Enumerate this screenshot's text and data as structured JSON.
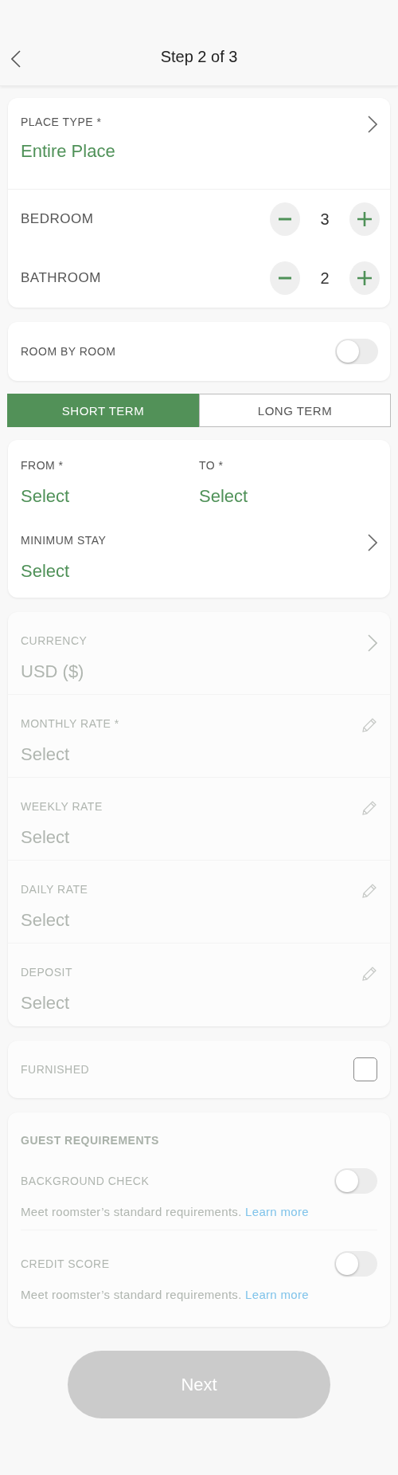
{
  "header": {
    "title": "Step 2 of 3"
  },
  "property": {
    "place_type": {
      "label": "PLACE TYPE *",
      "value": "Entire Place"
    },
    "counters": [
      {
        "label": "BEDROOM",
        "value": "3"
      },
      {
        "label": "BATHROOM",
        "value": "2"
      }
    ]
  },
  "room_by_room": {
    "label": "ROOM BY ROOM",
    "on": false
  },
  "term_tabs": [
    {
      "label": "SHORT TERM",
      "selected": true
    },
    {
      "label": "LONG TERM",
      "selected": false
    }
  ],
  "dates": {
    "from": {
      "label": "FROM *",
      "value": "Select"
    },
    "to": {
      "label": "TO *",
      "value": "Select"
    },
    "minimum_stay": {
      "label": "MINIMUM STAY",
      "value": "Select"
    }
  },
  "pricing": {
    "disabled": true,
    "fields": [
      {
        "kind": "select",
        "label": "CURRENCY",
        "value": "USD ($)"
      },
      {
        "kind": "edit",
        "label": "MONTHLY RATE *",
        "value": "Select"
      },
      {
        "kind": "edit",
        "label": "WEEKLY RATE",
        "value": "Select"
      },
      {
        "kind": "edit",
        "label": "DAILY RATE",
        "value": "Select"
      },
      {
        "kind": "edit",
        "label": "DEPOSIT",
        "value": "Select"
      }
    ]
  },
  "furnished": {
    "label": "FURNISHED",
    "checked": false,
    "disabled": true
  },
  "guest_requirements": {
    "title": "GUEST REQUIREMENTS",
    "disabled": true,
    "items": [
      {
        "label": "BACKGROUND CHECK",
        "on": false,
        "note": "Meet roomster’s standard requirements.",
        "link": "Learn more"
      },
      {
        "label": "CREDIT SCORE",
        "on": false,
        "note": "Meet roomster’s standard requirements.",
        "link": "Learn more"
      }
    ]
  },
  "next_button": {
    "label": "Next",
    "disabled": true
  }
}
